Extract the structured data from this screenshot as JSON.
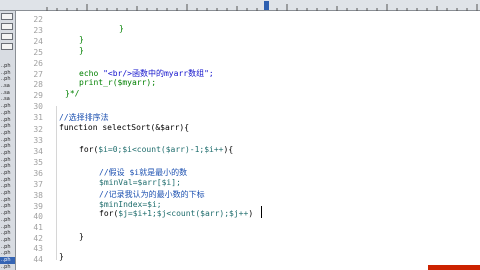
{
  "line_numbers": [
    "22",
    "23",
    "24",
    "25",
    "26",
    "27",
    "28",
    "29",
    "30",
    "31",
    "32",
    "33",
    "34",
    "35",
    "36",
    "37",
    "38",
    "39",
    "40",
    "41",
    "42",
    "43",
    "44"
  ],
  "sidebar": {
    "files": [
      "..ph",
      "..ph",
      "..ph",
      "..sa",
      "..sa",
      "..sa",
      "..ph",
      "..ph",
      "..ph",
      "..ph",
      "..ph",
      "..ph",
      "..ph",
      "..ph",
      "..ph",
      "..ph",
      "..ph",
      "..ph",
      "..ph",
      "..ph",
      "..ph",
      "..ph",
      "..ph",
      "..ph",
      "..ph",
      "..ph",
      "..ph",
      "..ph",
      "..ph",
      "..ph",
      "..ph"
    ]
  },
  "code": {
    "l23": "}",
    "l24": "}",
    "l25": "}",
    "l27_echo": "echo ",
    "l27_str": "\"<br/>函数中的myarr数组\";",
    "l28": "print_r($myarr);",
    "l29": "}*/",
    "l31": "//选择排序法",
    "l32": "function selectSort(&$arr){",
    "l34_for": "for(",
    "l34_var": "$i=0;$i<count($arr)-1;$i++",
    "l34_end": "){",
    "l36": "//假设 $i就是最小的数",
    "l37": "$minVal=$arr[$i];",
    "l38": "//记录我认为的最小数的下标",
    "l39": "$minIndex=$i;",
    "l40_for": "for(",
    "l40_var": "$j=$i+1;$j<count($arr);$j++",
    "l40_end": ")",
    "l42": "}",
    "l44": "}"
  },
  "subtitle": "",
  "colors": {
    "keyword_green": "#008000",
    "string_blue": "#1111cc",
    "variable_teal": "#1f6d6d",
    "comment_blue": "#1a4fb0",
    "subtitle_bar": "#cc2200"
  }
}
